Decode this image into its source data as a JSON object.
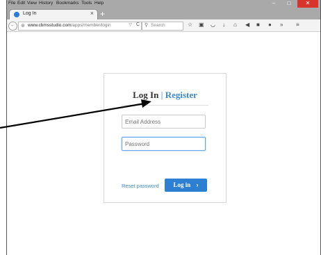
{
  "menubar": {
    "items": [
      "File",
      "Edit",
      "View",
      "History",
      "Bookmarks",
      "Tools",
      "Help"
    ],
    "minimize": "–",
    "maximize": "□",
    "close": "✕"
  },
  "tab": {
    "title": "Log In",
    "close": "×",
    "new_tab": "+"
  },
  "navbar": {
    "url_host": "www.cbmsstudio.com",
    "url_path": "/apps/member/login",
    "search_placeholder": "Search"
  },
  "login_form": {
    "title_login": "Log In",
    "title_separator": "|",
    "title_register": "Register",
    "email_placeholder": "Email Address",
    "password_placeholder": "Password",
    "reset_link": "Reset password",
    "login_button": "Log in",
    "login_button_chevron": "›"
  },
  "colors": {
    "accent": "#2d7fd1",
    "link": "#3a88cc",
    "chrome": "#a9a9a9",
    "close_button": "#d9342b"
  }
}
